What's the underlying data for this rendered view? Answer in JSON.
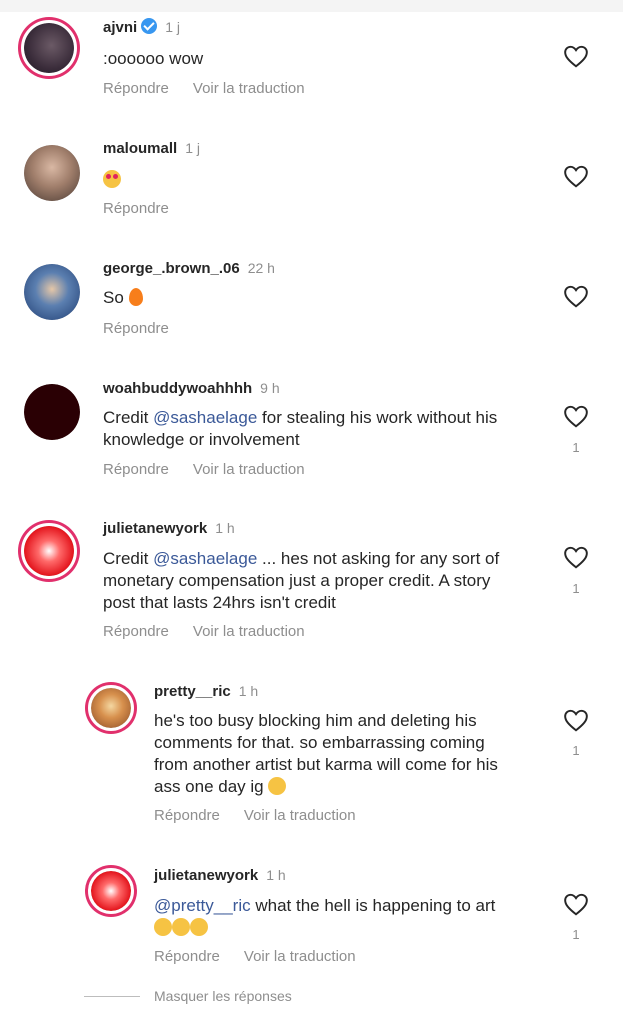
{
  "actions": {
    "reply": "Répondre",
    "translate": "Voir la traduction"
  },
  "hide_replies": "Masquer les réponses",
  "comments": [
    {
      "user": "ajvni",
      "verified": true,
      "time": "1 j",
      "text": ":oooooo wow",
      "show_translate": true,
      "likes": ""
    },
    {
      "user": "maloumall",
      "time": "1 j",
      "emoji": "heart-eyes-emoji",
      "show_translate": false,
      "likes": ""
    },
    {
      "user": "george_.brown_.06",
      "time": "22 h",
      "text": "So",
      "emoji": "fire-emoji",
      "show_translate": false,
      "likes": ""
    },
    {
      "user": "woahbuddywoahhhh",
      "time": "9 h",
      "text_pre": "Credit ",
      "mention": "@sashaelage",
      "text_post": " for stealing his work without his",
      "text2": "knowledge or involvement",
      "show_translate": true,
      "likes": "1"
    },
    {
      "user": "julietanewyork",
      "time": "1 h",
      "text_pre": "Credit ",
      "mention": "@sashaelage",
      "text_post": " ... hes not asking for any sort of",
      "text2": "monetary compensation just a proper credit. A story",
      "text3": "post that lasts 24hrs isn't credit",
      "show_translate": true,
      "likes": "1"
    },
    {
      "user": "pretty__ric",
      "time": "1 h",
      "text": "he's too busy blocking him and deleting his",
      "text2": "comments for that. so embarrassing coming",
      "text3": "from another artist but karma will come for his",
      "text4": "ass one day ig",
      "show_translate": true,
      "likes": "1"
    },
    {
      "user": "julietanewyork",
      "time": "1 h",
      "mention": "@pretty__ric",
      "text_post": " what the hell is happening to art",
      "show_translate": true,
      "likes": "1"
    }
  ],
  "colors": {
    "mention": "#3b5998",
    "ring": "#e1306c",
    "muted": "#8e8e8e"
  }
}
